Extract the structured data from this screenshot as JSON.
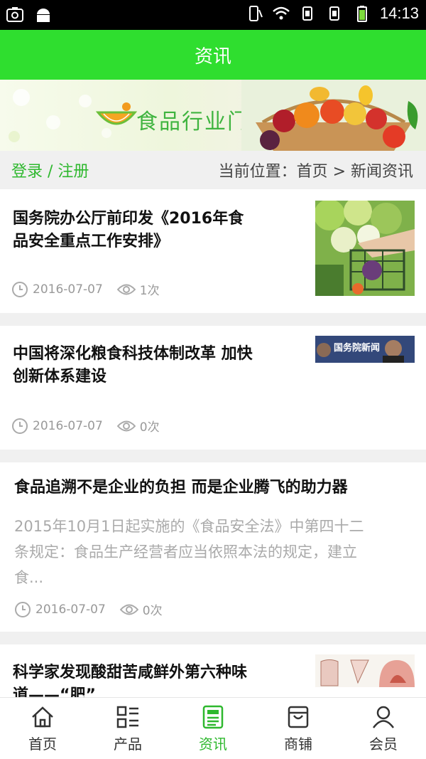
{
  "status_bar": {
    "time": "14:13"
  },
  "header": {
    "title": "资讯"
  },
  "banner": {
    "text": "食品行业门户"
  },
  "crumb": {
    "login": "登录 / 注册",
    "location": "当前位置：首页 > 新闻资讯"
  },
  "articles": [
    {
      "title_line1": "国务院办公厅前印发《2016年食",
      "title_line2": "品安全重点工作安排》",
      "date": "2016-07-07",
      "views": "1次"
    },
    {
      "title_line1": "中国将深化粮食科技体制改革 加快",
      "title_line2": "创新体系建设",
      "date": "2016-07-07",
      "views": "0次",
      "thumb_text": "国务院新闻"
    },
    {
      "title_line1": "食品追溯不是企业的负担 而是企业腾飞的助力器",
      "summary_line1": "2015年10月1日起实施的《食品安全法》中第四十二",
      "summary_line2": "条规定：食品生产经营者应当依照本法的规定，建立",
      "summary_line3": "食...",
      "date": "2016-07-07",
      "views": "0次"
    },
    {
      "title_line1": "科学家发现酸甜苦咸鲜外第六种味",
      "title_line2": "道——“肥”"
    }
  ],
  "nav": [
    {
      "label": "首页",
      "icon": "home-icon"
    },
    {
      "label": "产品",
      "icon": "grid-list-icon"
    },
    {
      "label": "资讯",
      "icon": "news-icon"
    },
    {
      "label": "商铺",
      "icon": "shop-icon"
    },
    {
      "label": "会员",
      "icon": "user-icon"
    }
  ],
  "colors": {
    "brand_green": "#2fde2f",
    "link_green": "#2eb82e"
  }
}
